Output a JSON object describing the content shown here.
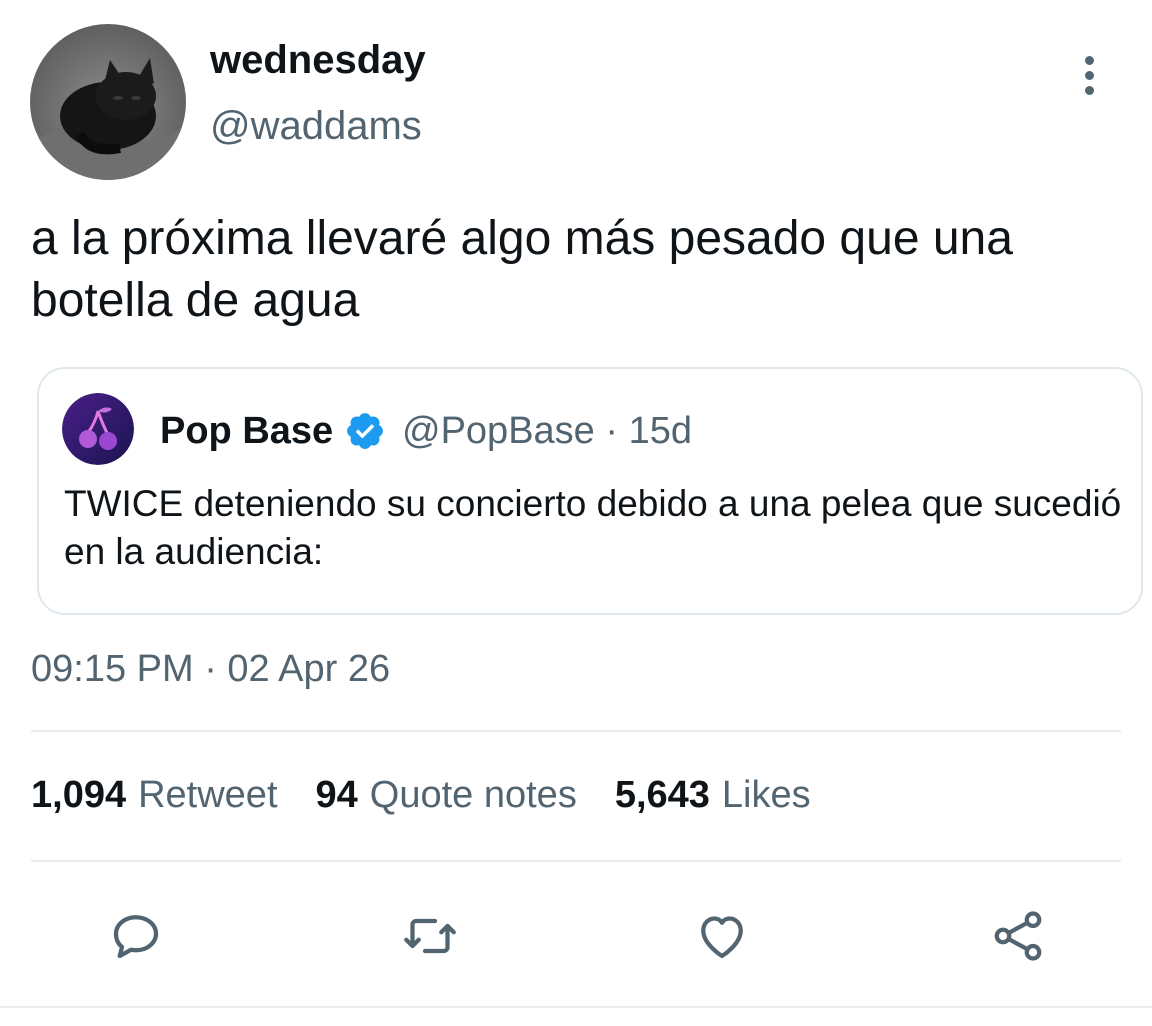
{
  "author": {
    "display_name": "wednesday",
    "handle": "@waddams"
  },
  "tweet": {
    "text": "a la próxima llevaré algo más pesado que una botella de agua",
    "timestamp": "09:15 PM · 02 Apr 26"
  },
  "quote": {
    "display_name": "Pop Base",
    "handle_time": "@PopBase · 15d",
    "text": "TWICE deteniendo su concierto debido a una pelea que sucedió en la audiencia:"
  },
  "stats": [
    {
      "count": "1,094",
      "label": "Retweet"
    },
    {
      "count": "94",
      "label": "Quote notes"
    },
    {
      "count": "5,643",
      "label": "Likes"
    }
  ],
  "icons": {
    "more": "more-vertical-icon",
    "verified": "verified-badge-icon",
    "reply": "reply-icon",
    "retweet": "retweet-icon",
    "like": "heart-icon",
    "share": "share-icon"
  },
  "colors": {
    "text": "#0f1419",
    "secondary": "#536471",
    "verified": "#1d9bf0",
    "border": "#e1e8ed"
  }
}
